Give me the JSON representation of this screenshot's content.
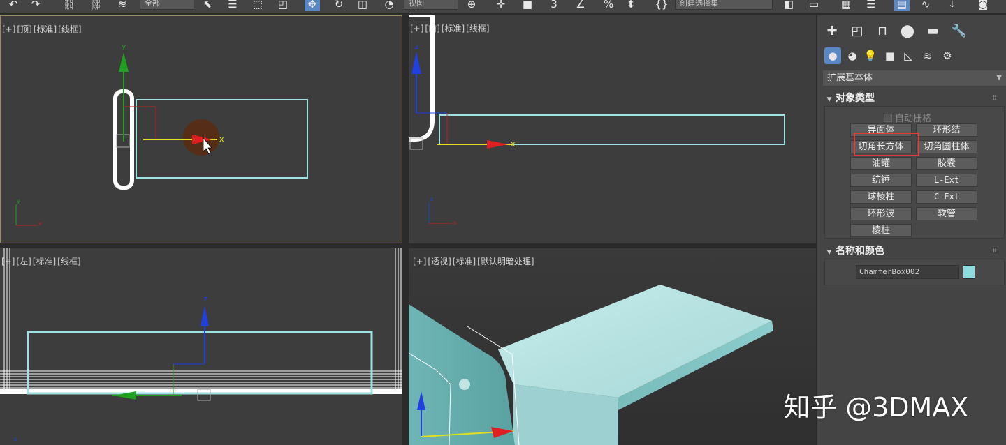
{
  "toolbar": {
    "selection_filter": "全部",
    "ref_coord": "视图",
    "named_selection": "创建选择集"
  },
  "viewports": {
    "top": {
      "labels": [
        "[+]",
        "[顶]",
        "[标准]",
        "[线框]"
      ]
    },
    "front": {
      "labels": [
        "[+]",
        "[前]",
        "[标准]",
        "[线框]"
      ]
    },
    "left": {
      "labels": [
        "[+]",
        "[左]",
        "[标准]",
        "[线框]"
      ]
    },
    "perspective": {
      "labels": [
        "[+]",
        "[透视]",
        "[标准]",
        "[默认明暗处理]"
      ]
    }
  },
  "axes": {
    "x": "x",
    "y": "y",
    "z": "z"
  },
  "panel": {
    "category": "扩展基本体",
    "object_type": {
      "title": "对象类型",
      "autogrid_label": "自动栅格",
      "buttons": [
        "异面体",
        "环形结",
        "切角长方体",
        "切角圆柱体",
        "油罐",
        "胶囊",
        "纺锤",
        "L-Ext",
        "球棱柱",
        "C-Ext",
        "环形波",
        "软管",
        "棱柱"
      ],
      "highlighted": "切角长方体"
    },
    "name_color": {
      "title": "名称和颜色",
      "object_name": "ChamferBox002",
      "color": "#8fdcdc"
    }
  },
  "colors": {
    "object_wire": "#9fe0e0",
    "selected_wire": "#ffffff",
    "axis_x": "#e02020",
    "axis_y": "#20a020",
    "axis_z": "#2040e0",
    "accent": "#5b87c4",
    "highlight_box": "#e33b3b"
  },
  "watermark": "知乎 @3DMAX"
}
